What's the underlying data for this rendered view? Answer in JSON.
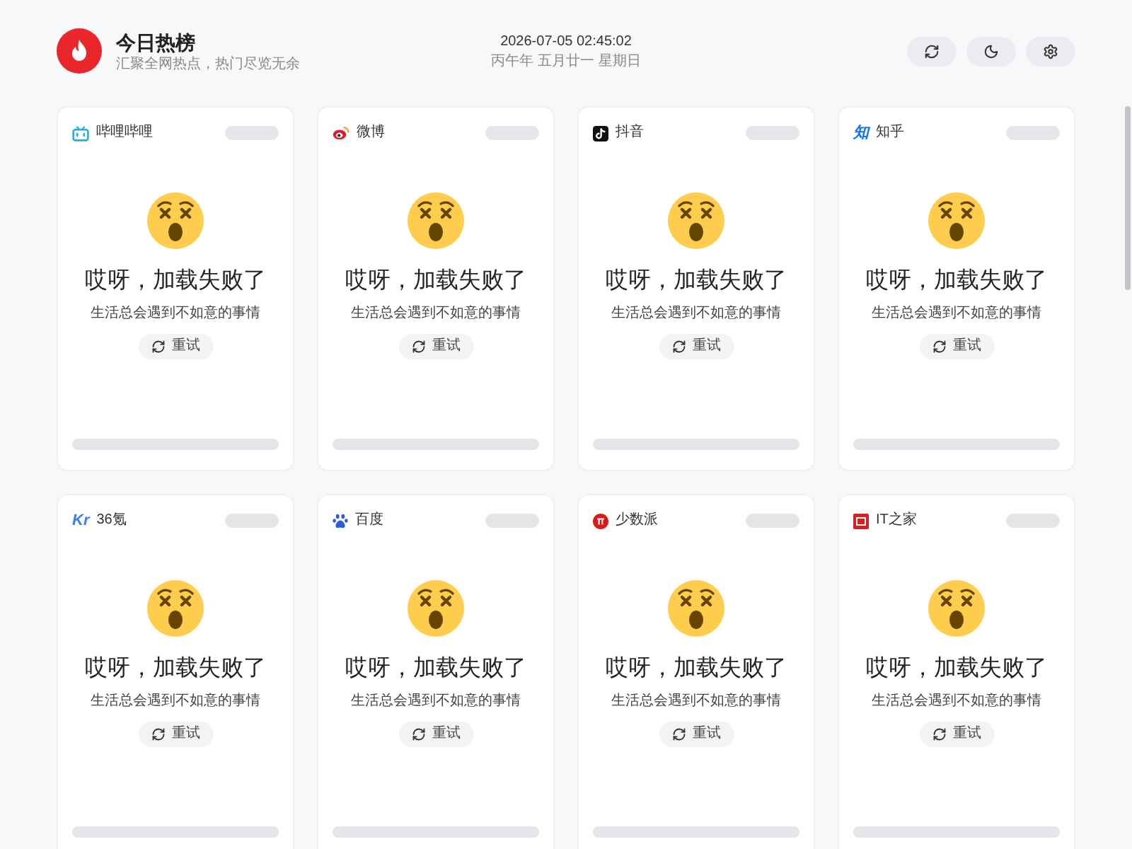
{
  "header": {
    "title": "今日热榜",
    "subtitle": "汇聚全网热点，热门尽览无余"
  },
  "clock": {
    "datetime": "2026-07-05 02:45:02",
    "lunar": "丙午年 五月廿一 星期日"
  },
  "toolbar": [
    {
      "kind": "refresh"
    },
    {
      "kind": "theme"
    },
    {
      "kind": "settings"
    }
  ],
  "cards": [
    {
      "source": "哔哩哔哩",
      "logo": {
        "kind": "tv"
      },
      "error": {
        "title": "哎呀，加载失败了",
        "message": "生活总会遇到不如意的事情",
        "retry": "重试"
      }
    },
    {
      "source": "微博",
      "logo": {
        "kind": "eye"
      },
      "error": {
        "title": "哎呀，加载失败了",
        "message": "生活总会遇到不如意的事情",
        "retry": "重试"
      }
    },
    {
      "source": "抖音",
      "logo": {
        "kind": "note"
      },
      "error": {
        "title": "哎呀，加载失败了",
        "message": "生活总会遇到不如意的事情",
        "retry": "重试"
      }
    },
    {
      "source": "知乎",
      "logo": {
        "kind": "glyph",
        "text": "知",
        "color": "#1772f6"
      },
      "error": {
        "title": "哎呀，加载失败了",
        "message": "生活总会遇到不如意的事情",
        "retry": "重试"
      }
    },
    {
      "source": "36氪",
      "logo": {
        "kind": "glyph",
        "text": "Kr",
        "color": "#3d7df0"
      },
      "error": {
        "title": "哎呀，加载失败了",
        "message": "生活总会遇到不如意的事情",
        "retry": "重试"
      }
    },
    {
      "source": "百度",
      "logo": {
        "kind": "paw"
      },
      "error": {
        "title": "哎呀，加载失败了",
        "message": "生活总会遇到不如意的事情",
        "retry": "重试"
      }
    },
    {
      "source": "少数派",
      "logo": {
        "kind": "disc"
      },
      "error": {
        "title": "哎呀，加载失败了",
        "message": "生活总会遇到不如意的事情",
        "retry": "重试"
      }
    },
    {
      "source": "IT之家",
      "logo": {
        "kind": "square"
      },
      "error": {
        "title": "哎呀，加载失败了",
        "message": "生活总会遇到不如意的事情",
        "retry": "重试"
      }
    }
  ]
}
